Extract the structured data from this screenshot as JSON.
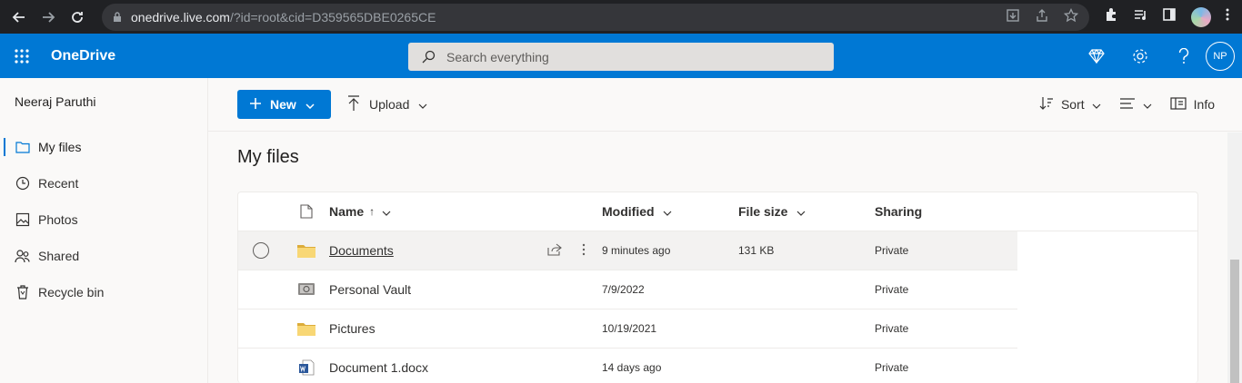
{
  "browser": {
    "url_host": "onedrive.live.com",
    "url_path": "/?id=root&cid=D359565DBE0265CE"
  },
  "appbar": {
    "brand": "OneDrive",
    "search_placeholder": "Search everything",
    "user_initials": "NP"
  },
  "sidebar": {
    "owner": "Neeraj Paruthi",
    "items": [
      {
        "label": "My files",
        "icon": "folder-icon"
      },
      {
        "label": "Recent",
        "icon": "clock-icon"
      },
      {
        "label": "Photos",
        "icon": "photo-icon"
      },
      {
        "label": "Shared",
        "icon": "people-icon"
      },
      {
        "label": "Recycle bin",
        "icon": "recycle-bin-icon"
      }
    ]
  },
  "commandbar": {
    "new_label": "New",
    "upload_label": "Upload",
    "sort_label": "Sort",
    "info_label": "Info"
  },
  "page": {
    "title": "My files"
  },
  "table": {
    "headers": {
      "name": "Name",
      "modified": "Modified",
      "size": "File size",
      "sharing": "Sharing"
    },
    "rows": [
      {
        "name": "Documents",
        "modified": "9 minutes ago",
        "size": "131 KB",
        "sharing": "Private",
        "icon": "folder-icon"
      },
      {
        "name": "Personal Vault",
        "modified": "7/9/2022",
        "size": "",
        "sharing": "Private",
        "icon": "vault-icon"
      },
      {
        "name": "Pictures",
        "modified": "10/19/2021",
        "size": "",
        "sharing": "Private",
        "icon": "folder-icon"
      },
      {
        "name": "Document 1.docx",
        "modified": "14 days ago",
        "size": "",
        "sharing": "Private",
        "icon": "word-doc-icon"
      }
    ]
  },
  "colors": {
    "accent": "#0078d4",
    "folder": "#f8d775"
  }
}
